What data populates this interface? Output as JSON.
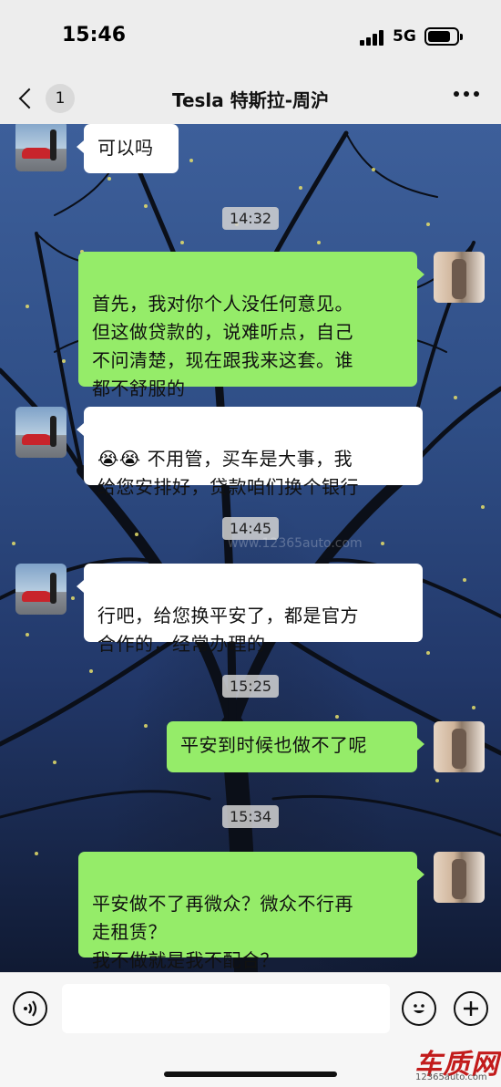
{
  "status_bar": {
    "time": "15:46",
    "network": "5G"
  },
  "nav": {
    "back_count": "1",
    "title": "Tesla 特斯拉-周沪"
  },
  "messages": [
    {
      "text": "可以吗"
    },
    {
      "text": "首先，我对你个人没任何意见。\n但这做贷款的，说难听点，自己\n不问清楚，现在跟我来这套。谁\n都不舒服的"
    },
    {
      "text": "😭😭 不用管，买车是大事，我\n给您安排好，贷款咱们换个银行"
    },
    {
      "text": "行吧，给您换平安了，都是官方\n合作的，经常办理的"
    },
    {
      "text": "平安到时候也做不了呢"
    },
    {
      "text": "平安做不了再微众？微众不行再\n走租赁？\n我不做就是我不配合？"
    }
  ],
  "timestamps": [
    "14:32",
    "14:45",
    "15:25",
    "15:34"
  ],
  "input": {
    "placeholder": ""
  },
  "icons": [
    "signal-icon",
    "battery-icon",
    "back-chevron-icon",
    "more-icon",
    "voice-icon",
    "emoji-icon",
    "plus-icon"
  ],
  "watermark": {
    "main": "车质网",
    "sub": "12365auto.com",
    "faint": "www.12365auto.com"
  },
  "colors": {
    "incoming_bubble": "#ffffff",
    "outgoing_bubble": "#95ec69",
    "bar_bg": "#ededed"
  }
}
